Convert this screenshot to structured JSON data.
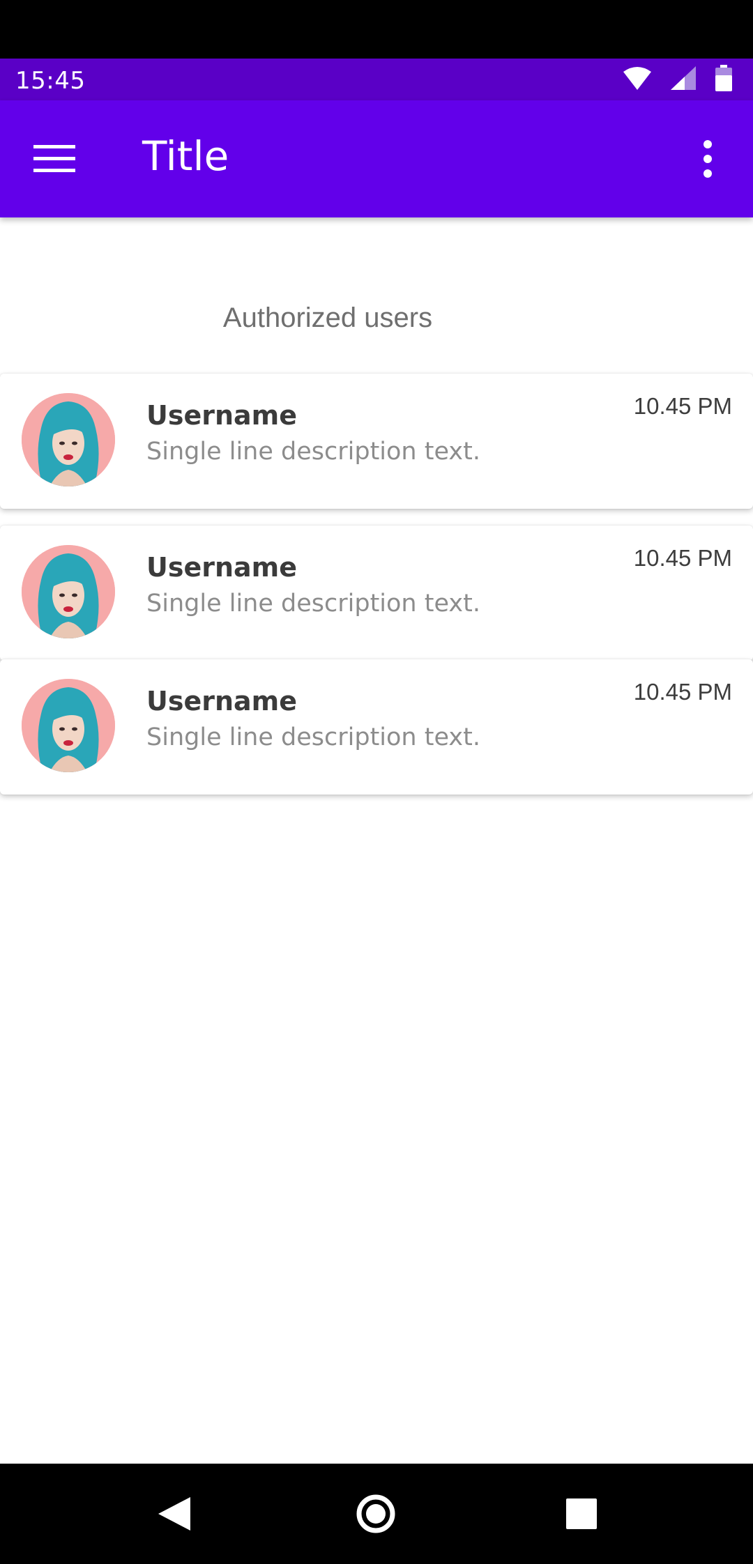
{
  "status_bar": {
    "time": "15:45",
    "background": "#5a00c6",
    "icons": [
      "wifi-icon",
      "cellular-signal-icon",
      "battery-icon"
    ]
  },
  "app_bar": {
    "title": "Title",
    "background": "#6200ea",
    "menu_icon": "hamburger-menu-icon",
    "overflow_icon": "more-vert-icon"
  },
  "section": {
    "heading": "Authorized users"
  },
  "users": [
    {
      "username": "Username",
      "description": "Single line description text.",
      "time": "10.45 PM",
      "avatar": "avatar-woman-teal-hair"
    },
    {
      "username": "Username",
      "description": "Single line description text.",
      "time": "10.45 PM",
      "avatar": "avatar-woman-teal-hair"
    },
    {
      "username": "Username",
      "description": "Single line description text.",
      "time": "10.45 PM",
      "avatar": "avatar-woman-teal-hair"
    }
  ],
  "nav_bar": {
    "icons": [
      "back-icon",
      "home-icon",
      "recents-icon"
    ]
  }
}
